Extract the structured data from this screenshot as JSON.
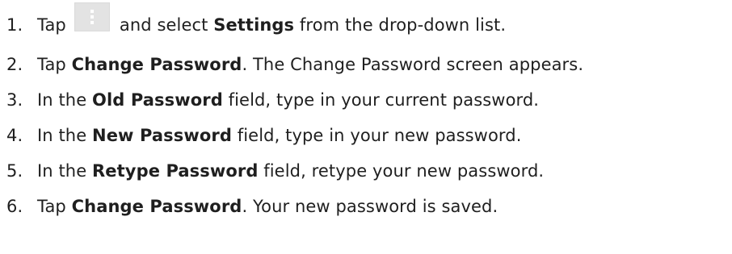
{
  "steps": [
    {
      "num": "1.",
      "parts": [
        {
          "t": "Tap",
          "b": false
        },
        {
          "icon": "overflow-menu-icon"
        },
        {
          "t": "and select ",
          "b": false
        },
        {
          "t": "Settings",
          "b": true
        },
        {
          "t": " from the drop-down list.",
          "b": false
        }
      ]
    },
    {
      "num": "2.",
      "parts": [
        {
          "t": "Tap ",
          "b": false
        },
        {
          "t": "Change Password",
          "b": true
        },
        {
          "t": ". The Change Password screen appears.",
          "b": false
        }
      ]
    },
    {
      "num": "3.",
      "parts": [
        {
          "t": "In the ",
          "b": false
        },
        {
          "t": "Old Password",
          "b": true
        },
        {
          "t": " field, type in your current password.",
          "b": false
        }
      ]
    },
    {
      "num": "4.",
      "parts": [
        {
          "t": "In the ",
          "b": false
        },
        {
          "t": "New Password",
          "b": true
        },
        {
          "t": " field, type in your new password.",
          "b": false
        }
      ]
    },
    {
      "num": "5.",
      "parts": [
        {
          "t": "In the ",
          "b": false
        },
        {
          "t": "Retype Password",
          "b": true
        },
        {
          "t": " field, retype your new password.",
          "b": false
        }
      ]
    },
    {
      "num": "6.",
      "parts": [
        {
          "t": "Tap ",
          "b": false
        },
        {
          "t": "Change Password",
          "b": true
        },
        {
          "t": ". Your new password is saved.",
          "b": false
        }
      ]
    }
  ]
}
